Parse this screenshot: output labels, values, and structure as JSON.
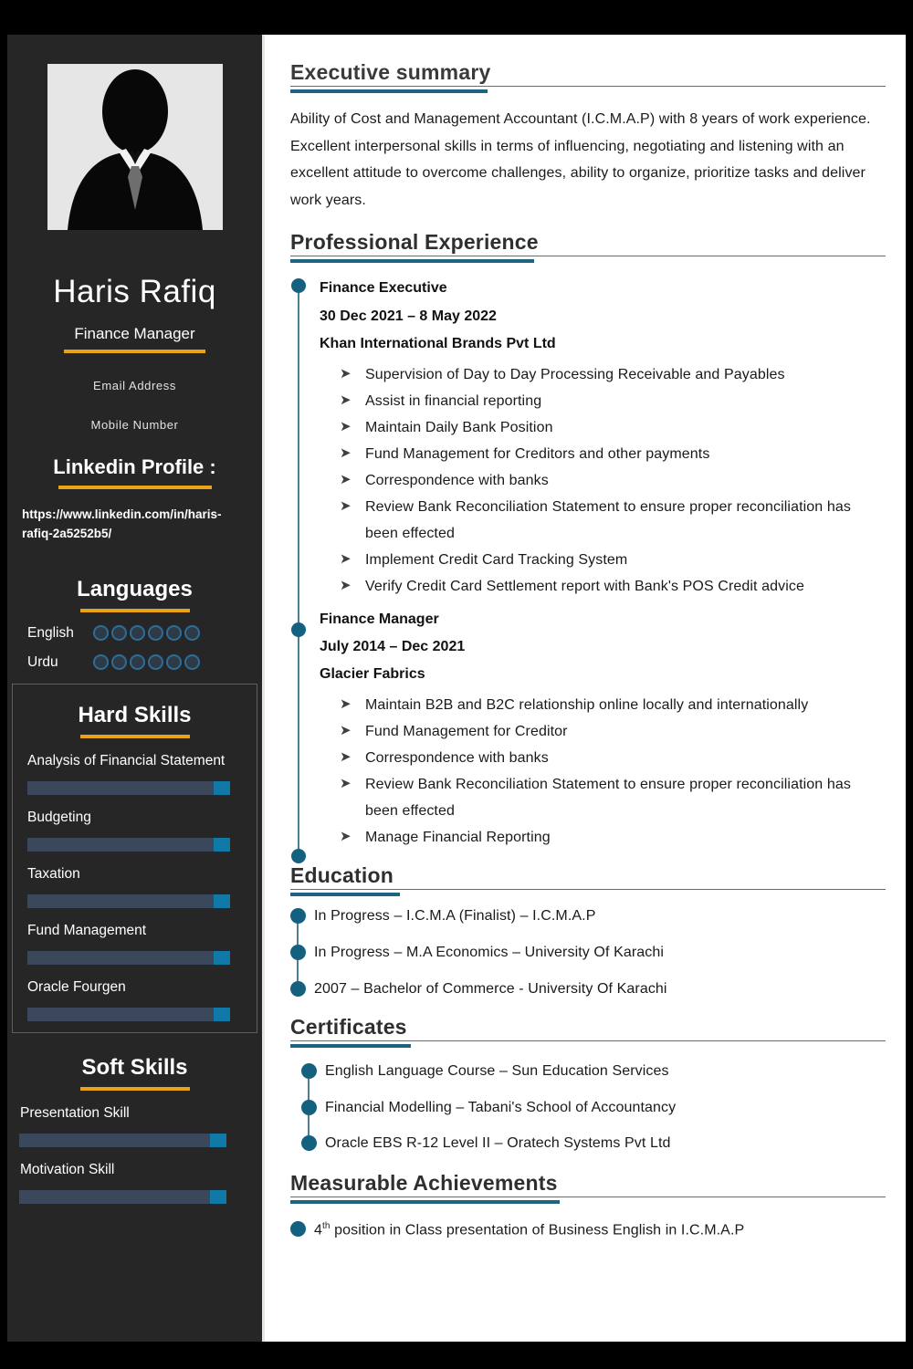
{
  "colors": {
    "sidebar_bg": "#262626",
    "accent_gold": "#e8a317",
    "accent_blue": "#14617f",
    "bar_track": "#3b475a",
    "bar_fill": "#1179a8",
    "page_border": "#000000"
  },
  "sidebar": {
    "avatar_icon": "person-silhouette-icon",
    "name": "Haris Rafiq",
    "role": "Finance Manager",
    "contacts": [
      {
        "label": "Email Address"
      },
      {
        "label": "Mobile Number"
      }
    ],
    "linkedin": {
      "heading": "Linkedin Profile :",
      "url": "https://www.linkedin.com/in/haris-rafiq-2a5252b5/"
    },
    "languages": {
      "heading": "Languages",
      "items": [
        {
          "label": "English",
          "dots": 6,
          "filled": 0
        },
        {
          "label": "Urdu",
          "dots": 6,
          "filled": 0
        }
      ]
    },
    "hard_skills": {
      "heading": "Hard Skills",
      "items": [
        {
          "label": "Analysis of Financial Statement",
          "level": 92
        },
        {
          "label": "Budgeting",
          "level": 92
        },
        {
          "label": "Taxation",
          "level": 92
        },
        {
          "label": "Fund Management",
          "level": 92
        },
        {
          "label": "Oracle Fourgen",
          "level": 92
        }
      ]
    },
    "soft_skills": {
      "heading": "Soft Skills",
      "items": [
        {
          "label": "Presentation Skill",
          "level": 92
        },
        {
          "label": "Motivation Skill",
          "level": 92
        }
      ]
    }
  },
  "main": {
    "executive_summary": {
      "heading": "Executive summary",
      "body": "Ability of Cost and Management Accountant (I.C.M.A.P) with 8 years of work experience. Excellent interpersonal skills in terms of influencing, negotiating and listening with an excellent attitude to overcome challenges, ability to organize, prioritize tasks and deliver work years."
    },
    "professional_experience": {
      "heading": "Professional Experience",
      "jobs": [
        {
          "title": "Finance Executive",
          "dates": "30 Dec 2021 – 8 May 2022",
          "company": "Khan International Brands Pvt Ltd",
          "duties": [
            "Supervision of Day to Day Processing Receivable and Payables",
            "Assist in financial reporting",
            "Maintain Daily Bank Position",
            "Fund Management for Creditors and other payments",
            "Correspondence with banks",
            "Review Bank Reconciliation Statement to ensure proper reconciliation has been effected",
            "Implement Credit Card Tracking System",
            "Verify Credit Card Settlement report with Bank's POS Credit advice"
          ]
        },
        {
          "title": "Finance Manager",
          "dates": "July 2014 – Dec 2021",
          "company": "Glacier Fabrics",
          "duties": [
            "Maintain B2B and B2C relationship online locally and internationally",
            "Fund Management for Creditor",
            "Correspondence with banks",
            "Review Bank Reconciliation Statement to ensure proper reconciliation has been effected",
            "Manage Financial Reporting"
          ]
        }
      ]
    },
    "education": {
      "heading": "Education",
      "items": [
        "In Progress – I.C.M.A (Finalist) – I.C.M.A.P",
        "In Progress – M.A Economics – University Of Karachi",
        "2007           – Bachelor of Commerce - University Of Karachi"
      ]
    },
    "certificates": {
      "heading": "Certificates",
      "items": [
        "English Language Course – Sun Education Services",
        "Financial Modelling – Tabani's School of Accountancy",
        "Oracle EBS R-12 Level II – Oratech Systems Pvt Ltd"
      ]
    },
    "measurable_achievements": {
      "heading": "Measurable Achievements",
      "items": [
        {
          "prefix": "4",
          "sup": "th",
          "rest": " position in Class presentation of Business English in I.C.M.A.P"
        }
      ]
    }
  }
}
